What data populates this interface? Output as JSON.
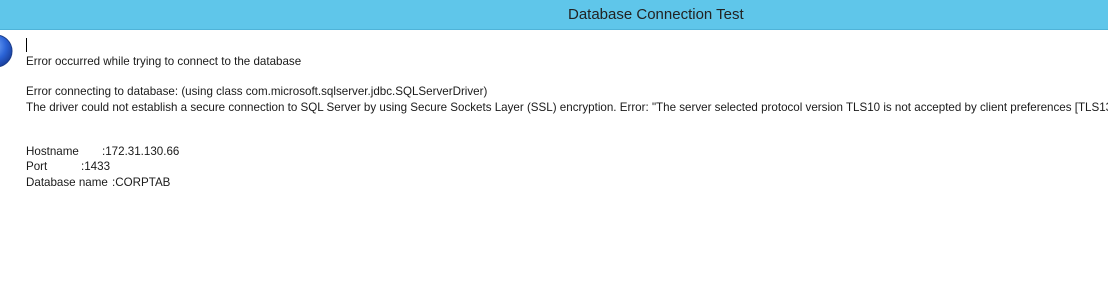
{
  "window": {
    "title": "Database Connection Test",
    "accent_color": "#5fc6ea"
  },
  "dialog": {
    "icon": "info-icon",
    "message_header": "Error occurred while trying to connect to the database",
    "error_line1": "Error connecting to database: (using class com.microsoft.sqlserver.jdbc.SQLServerDriver)",
    "error_line2": "The driver could not establish a secure connection to SQL Server by using Secure Sockets Layer (SSL) encryption. Error: \"The server selected protocol version TLS10 is not accepted by client preferences [TLS13",
    "details": [
      {
        "label": "Hostname",
        "value": ":172.31.130.66"
      },
      {
        "label": "Port",
        "value": ":1433"
      },
      {
        "label": "Database name",
        "value": ":CORPTAB"
      }
    ]
  }
}
